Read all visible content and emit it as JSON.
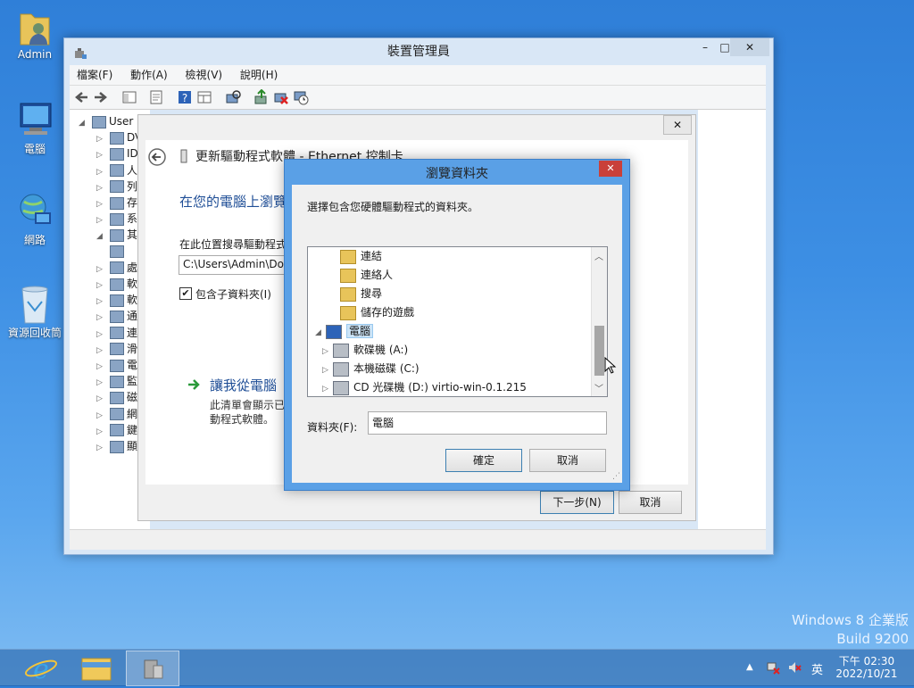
{
  "desktop": {
    "icons": [
      {
        "label": "Admin"
      },
      {
        "label": "電腦"
      },
      {
        "label": "網路"
      },
      {
        "label": "資源回收筒"
      }
    ],
    "watermark": {
      "line1": "Windows 8 企業版",
      "line2": "Build 9200"
    }
  },
  "device_manager": {
    "title": "裝置管理員",
    "caption": {
      "minimize": "–",
      "maximize": "□",
      "close": "✕"
    },
    "menu": [
      "檔案(F)",
      "動作(A)",
      "檢視(V)",
      "說明(H)"
    ],
    "tree": [
      {
        "label": "User",
        "expander": "◢"
      },
      {
        "label": "DV",
        "expander": "▷"
      },
      {
        "label": "ID",
        "expander": "▷"
      },
      {
        "label": "人",
        "expander": "▷"
      },
      {
        "label": "列",
        "expander": "▷"
      },
      {
        "label": "存",
        "expander": "▷"
      },
      {
        "label": "系",
        "expander": "▷"
      },
      {
        "label": "其",
        "expander": "◢"
      },
      {
        "label": "",
        "expander": ""
      },
      {
        "label": "處",
        "expander": "▷"
      },
      {
        "label": "軟",
        "expander": "▷"
      },
      {
        "label": "軟",
        "expander": "▷"
      },
      {
        "label": "通",
        "expander": "▷"
      },
      {
        "label": "連",
        "expander": "▷"
      },
      {
        "label": "滑",
        "expander": "▷"
      },
      {
        "label": "電",
        "expander": "▷"
      },
      {
        "label": "監",
        "expander": "▷"
      },
      {
        "label": "磁",
        "expander": "▷"
      },
      {
        "label": "網",
        "expander": "▷"
      },
      {
        "label": "鍵",
        "expander": "▷"
      },
      {
        "label": "顯",
        "expander": "▷"
      }
    ]
  },
  "wizard": {
    "close": "✕",
    "header": "更新驅動程式軟體 - Ethernet 控制卡",
    "heading": "在您的電腦上瀏覽",
    "search_label": "在此位置搜尋驅動程式",
    "path_value": "C:\\Users\\Admin\\Doc",
    "include_subfolders": "包含子資料夾(I)",
    "option_title": "讓我從電腦",
    "option_desc_1": "此清單會顯示已",
    "option_desc_2": "動程式軟體。",
    "next": "下一步(N)",
    "cancel": "取消"
  },
  "browse_dialog": {
    "title": "瀏覽資料夾",
    "close": "✕",
    "instruction": "選擇包含您硬體驅動程式的資料夾。",
    "items": [
      {
        "label": "連結",
        "icon": "folder-links-icon",
        "expander": ""
      },
      {
        "label": "連絡人",
        "icon": "folder-contacts-icon",
        "expander": ""
      },
      {
        "label": "搜尋",
        "icon": "folder-search-icon",
        "expander": ""
      },
      {
        "label": "儲存的遊戲",
        "icon": "folder-saved-games-icon",
        "expander": ""
      },
      {
        "label": "電腦",
        "icon": "computer-icon",
        "expander": "◢",
        "selected": true
      },
      {
        "label": "軟碟機 (A:)",
        "icon": "floppy-drive-icon",
        "expander": "▷"
      },
      {
        "label": "本機磁碟 (C:)",
        "icon": "local-disk-icon",
        "expander": "▷"
      },
      {
        "label": "CD 光碟機 (D:) virtio-win-0.1.215",
        "icon": "cd-drive-icon",
        "expander": "▷"
      }
    ],
    "folder_label": "資料夾(F):",
    "folder_value": "電腦",
    "ok": "確定",
    "cancel": "取消"
  },
  "taskbar": {
    "ime": "英",
    "time": "下午 02:30",
    "date": "2022/10/21",
    "tray_arrow": "▲"
  }
}
